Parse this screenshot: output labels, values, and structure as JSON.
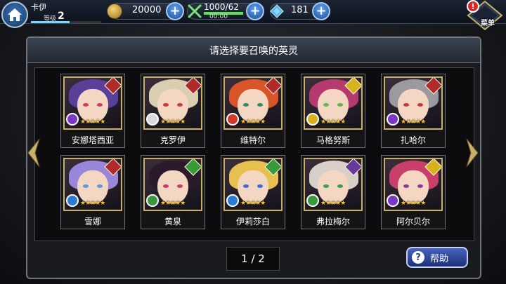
{
  "player": {
    "name": "卡伊",
    "level_label": "等级",
    "level": "2"
  },
  "currency": {
    "gold": "20000",
    "stamina": "1000/62",
    "stamina_timer": "00:00",
    "gems": "181"
  },
  "menu": {
    "label": "菜单",
    "alert": "!"
  },
  "panel": {
    "title": "请选择要召唤的英灵"
  },
  "heroes": [
    {
      "name": "安娜塔西亚",
      "stars": "★★★★★",
      "hair": "#5a3f9a",
      "eye": "#d33a6a",
      "class_color": "#b02a2a",
      "elem_color": "#7a38c8"
    },
    {
      "name": "克罗伊",
      "stars": "★★★★★",
      "hair": "#d9cfb0",
      "eye": "#c83a3a",
      "class_color": "#b02a2a",
      "elem_color": "#d8d8e0"
    },
    {
      "name": "维特尔",
      "stars": "★★★★★",
      "hair": "#d8552a",
      "eye": "#2d8f5e",
      "class_color": "#b02a2a",
      "elem_color": "#d23a2a"
    },
    {
      "name": "马格努斯",
      "stars": "★★★★★",
      "hair": "#b53a6e",
      "eye": "#5cb84a",
      "class_color": "#d8b21e",
      "elem_color": "#d8b21e"
    },
    {
      "name": "扎哈尔",
      "stars": "★★★★★",
      "hair": "#9a9aa0",
      "eye": "#c83a3a",
      "class_color": "#b02a2a",
      "elem_color": "#7a38c8"
    },
    {
      "name": "雪娜",
      "stars": "★★★★★",
      "hair": "#9a86d8",
      "eye": "#5a9ad8",
      "class_color": "#b02a2a",
      "elem_color": "#2a7ad8"
    },
    {
      "name": "黄泉",
      "stars": "★★★★★",
      "hair": "#2a1a2a",
      "eye": "#c83a6a",
      "class_color": "#3a9a3a",
      "elem_color": "#3a9a3a"
    },
    {
      "name": "伊莉莎白",
      "stars": "★★★★★",
      "hair": "#e8c050",
      "eye": "#3a6ad8",
      "class_color": "#3a9a3a",
      "elem_color": "#2a7ad8"
    },
    {
      "name": "弗拉梅尔",
      "stars": "★★★★★",
      "hair": "#d8d0c8",
      "eye": "#3a9a5a",
      "class_color": "#6a3a9a",
      "elem_color": "#3a9a3a"
    },
    {
      "name": "阿尔贝尔",
      "stars": "★★★★★",
      "hair": "#c8406a",
      "eye": "#8a3a9a",
      "class_color": "#d8b21e",
      "elem_color": "#7a38c8"
    }
  ],
  "pagination": {
    "text": "1 / 2"
  },
  "help": {
    "label": "帮助"
  }
}
